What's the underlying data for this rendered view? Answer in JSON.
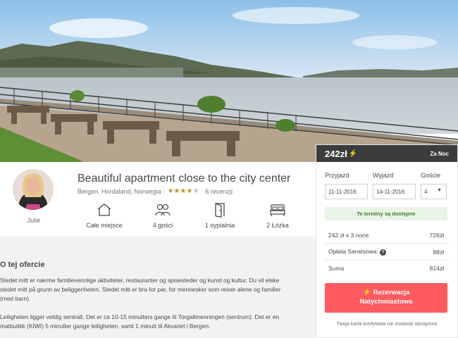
{
  "host": {
    "name": "Julie"
  },
  "listing": {
    "title": "Beautiful apartment close to the city center",
    "location": "Bergen, Hordaland, Norwegia",
    "rating": 4,
    "rating_max": 5,
    "reviews": "6 recenzji",
    "features": [
      {
        "icon": "house-icon",
        "label": "Całe miejsce"
      },
      {
        "icon": "guests-icon",
        "label": "4 gości"
      },
      {
        "icon": "door-icon",
        "label": "1 sypialnia"
      },
      {
        "icon": "bed-icon",
        "label": "2 Łóżka"
      }
    ]
  },
  "about": {
    "heading": "O tej ofercie",
    "paragraphs": [
      "Stedet mitt er nærme familievennlige aktiviteter, restauranter og spisesteder og kunst og kultur. Du vil elske",
      "stedet mitt på grunn av beliggenheten. Stedet mitt er bra for par, for mennesker som reiser alene og familier",
      "(med barn).",
      "Leiligheten ligger veldig sentralt. Det er ca 10-15 minutters gange til Torgallmenningen (sentrum). Det er en",
      "matbutikk (KIWI) 5 minutter gange leiligheten, samt 1 minutt til Akvariet i Bergen."
    ]
  },
  "booking": {
    "price": "242zł",
    "per_night": "Za Noc",
    "checkin_label": "Przyjazd",
    "checkout_label": "Wyjazd",
    "guests_label": "Goście",
    "checkin_value": "11-11-2016",
    "checkout_value": "14-11-2016",
    "guests_value": "4",
    "availability": "Te terminy są dostępne",
    "lines": [
      {
        "label": "242 zł x 3 noce",
        "value": "726zł"
      },
      {
        "label": "Opłata Serwisowa",
        "value": "88zł"
      },
      {
        "label": "Suma",
        "value": "814zł"
      }
    ],
    "book_line1": "Rezerwacja",
    "book_line2": "Natychmiastowa",
    "note": "Twoja karta kredytowa nie zostanie obciążona"
  },
  "colors": {
    "accent": "#ff5a5f",
    "price_bar": "#3c3c3c",
    "availability_bg": "#e9f4e6",
    "instant_bolt": "#f7b12c"
  }
}
